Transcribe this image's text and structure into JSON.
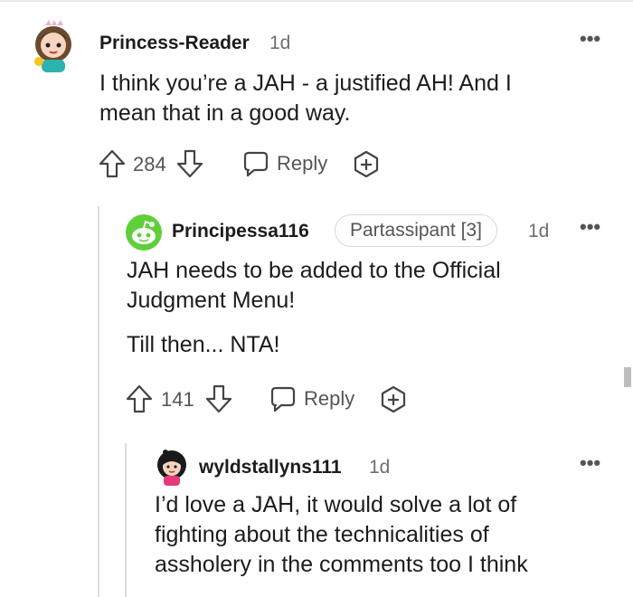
{
  "comments": [
    {
      "username": "Princess-Reader",
      "time": "1d",
      "body": [
        "I think you’re a JAH - a justified AH! And I mean that in a good way."
      ],
      "votes": "284",
      "reply_label": "Reply",
      "avatar_icon": "princess-avatar-icon"
    },
    {
      "username": "Principessa116",
      "flair": "Partassipant [3]",
      "time": "1d",
      "body": [
        "JAH needs to be added to the Official Judgment Menu!",
        "Till then... NTA!"
      ],
      "votes": "141",
      "reply_label": "Reply",
      "avatar_icon": "snoo-avatar-icon"
    },
    {
      "username": "wyldstallyns111",
      "time": "1d",
      "body": [
        "I’d love a JAH, it would solve a lot of fighting about the technicalities of assholery in the comments too I think"
      ],
      "avatar_icon": "girl-avatar-icon"
    }
  ],
  "colors": {
    "snoo_green": "#5fcf3a",
    "text": "#1c1c1c",
    "muted": "#6f6f6f"
  }
}
